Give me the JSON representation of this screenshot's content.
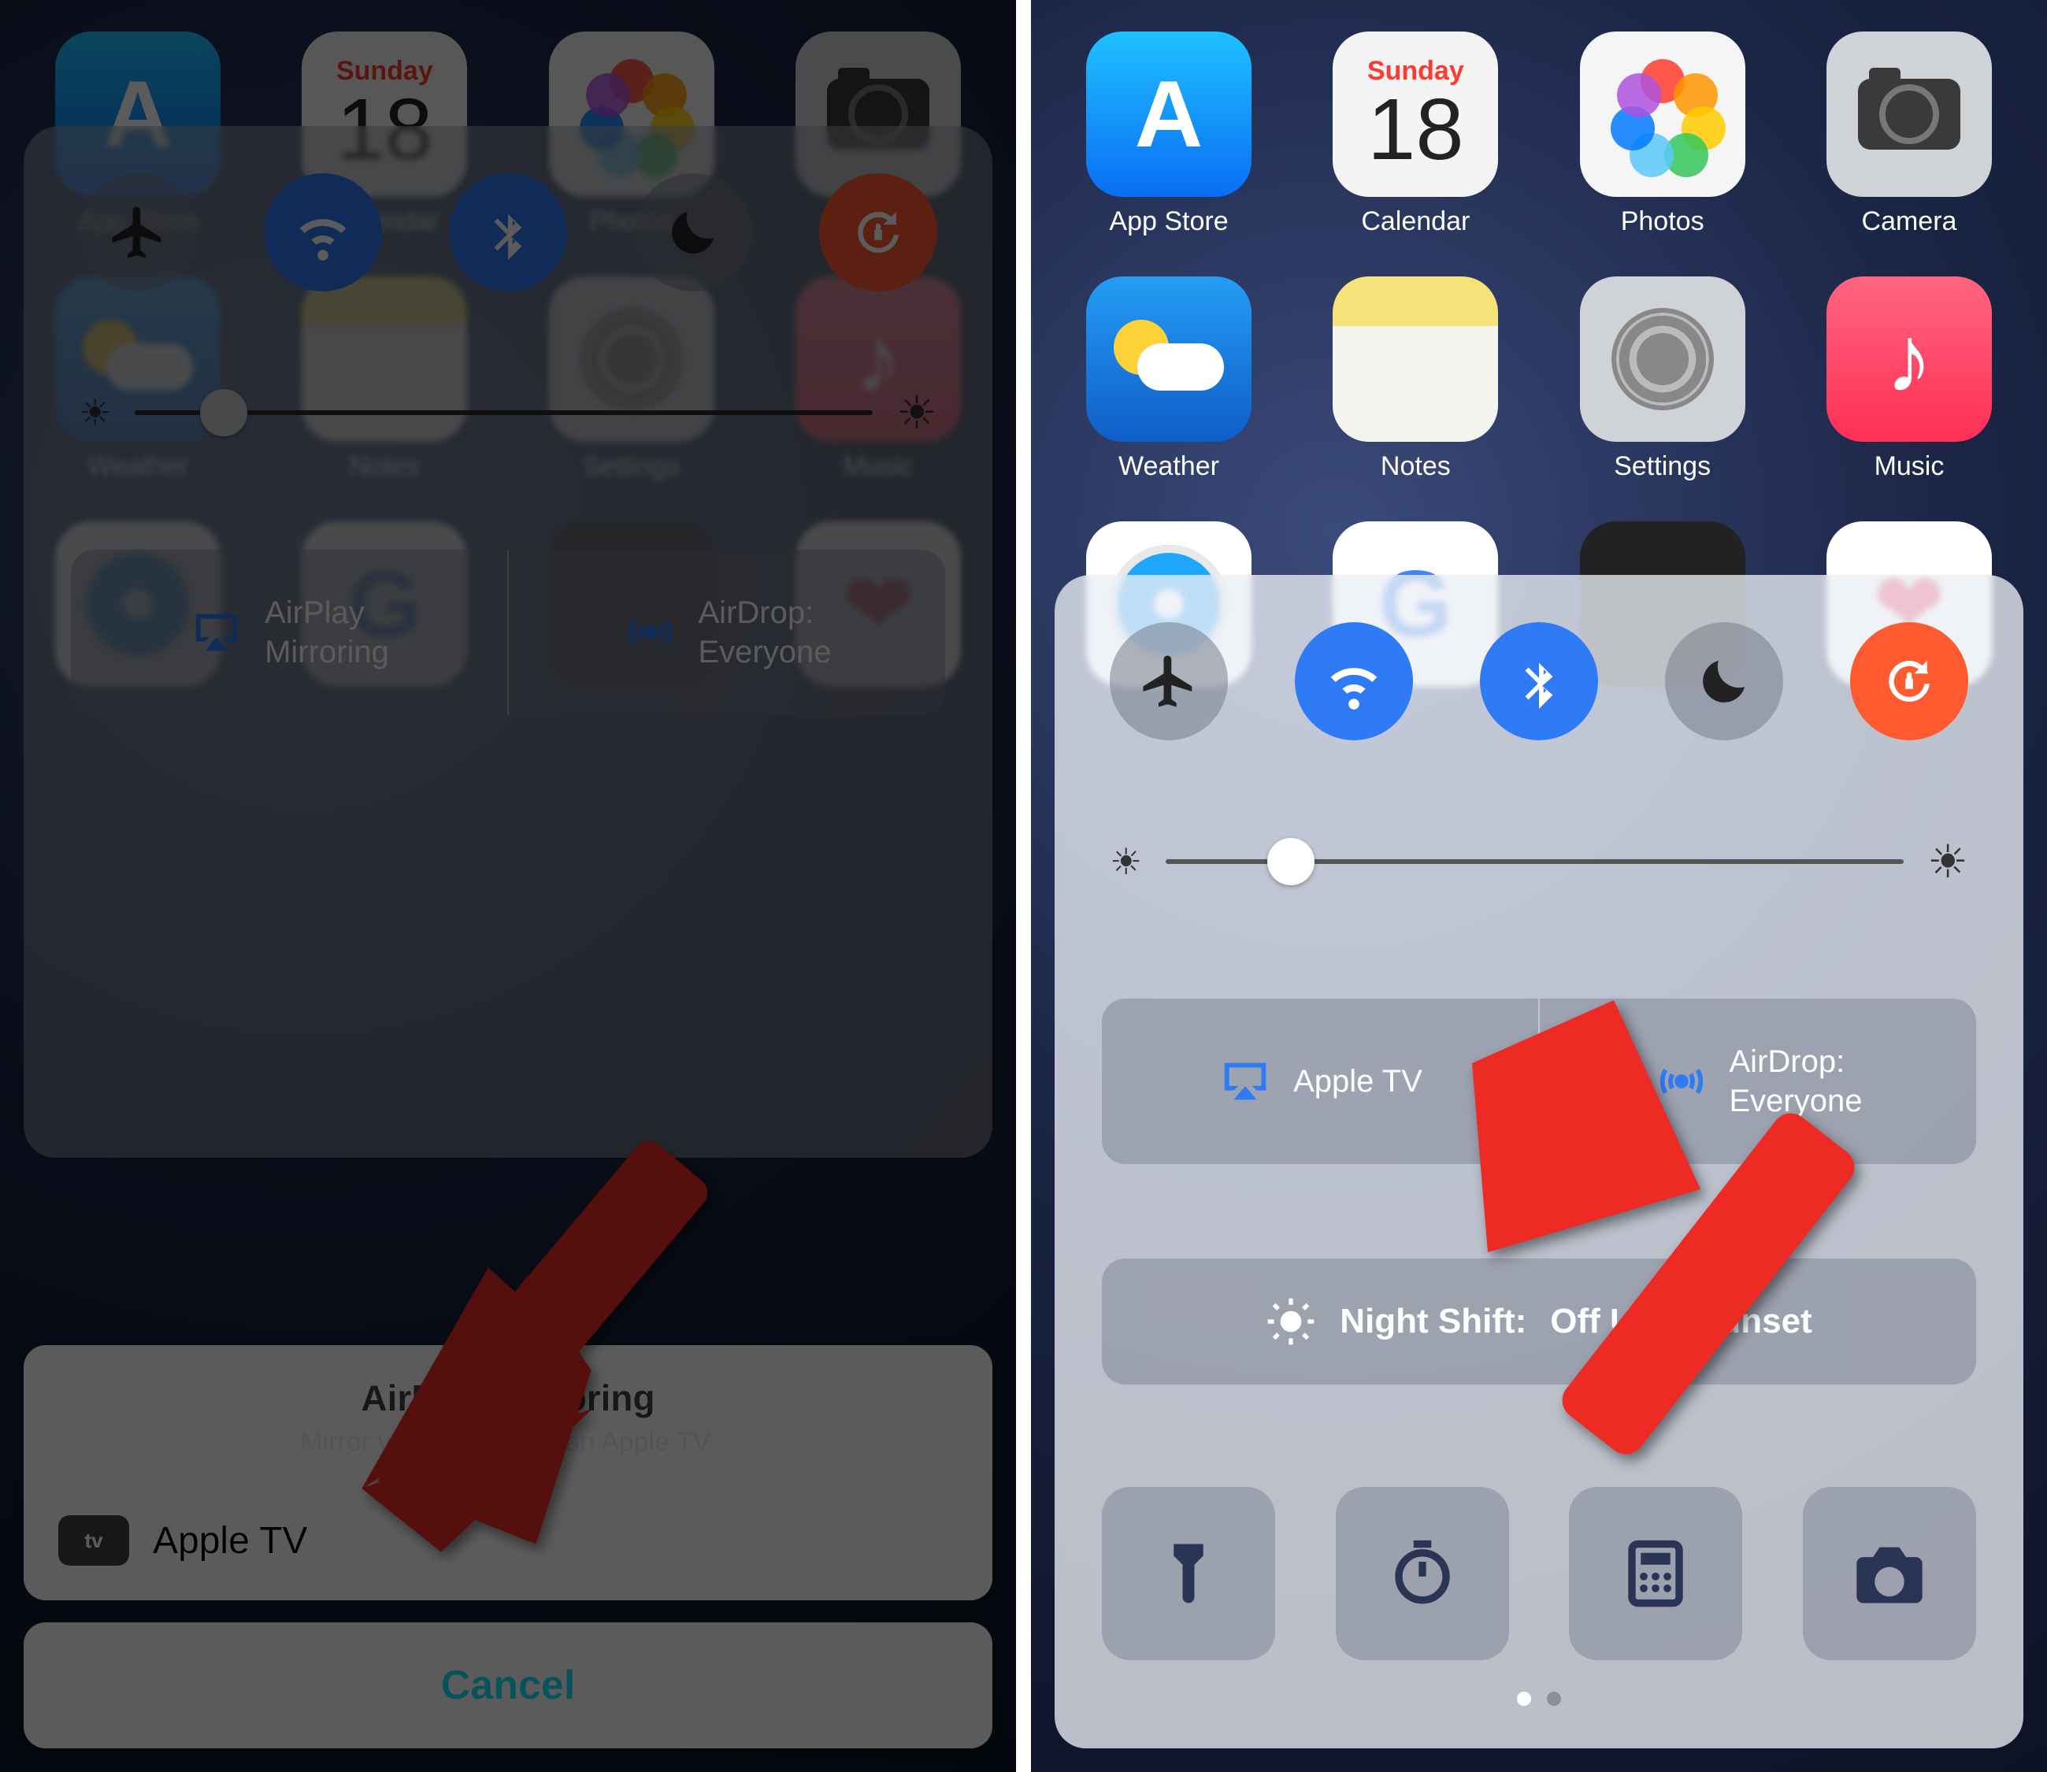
{
  "calendar": {
    "dow": "Sunday",
    "day": "18"
  },
  "apps": {
    "appstore": "App Store",
    "calendar": "Calendar",
    "photos": "Photos",
    "camera": "Camera",
    "weather": "Weather",
    "notes": "Notes",
    "settings": "Settings",
    "music": "Music"
  },
  "cc": {
    "airplay_mirroring_line1": "AirPlay",
    "airplay_mirroring_line2": "Mirroring",
    "appletv_label": "Apple TV",
    "airdrop_line1": "AirDrop:",
    "airdrop_line2": "Everyone",
    "nightshift_prefix": "Night Shift:",
    "nightshift_value": "Off Until Sunset",
    "brightness_pct_left": 12,
    "brightness_pct_right": 17
  },
  "sheet": {
    "title": "AirPlay Mirroring",
    "subtitle": "Mirror your iPhone on an Apple TV.",
    "device": "Apple TV",
    "atv_badge": "tv",
    "cancel": "Cancel"
  },
  "colors": {
    "toggle_blue": "#2f7af5",
    "toggle_red": "#ff5a30",
    "arrow_red": "#ed2a24",
    "ios_blue": "#0a7aff"
  }
}
